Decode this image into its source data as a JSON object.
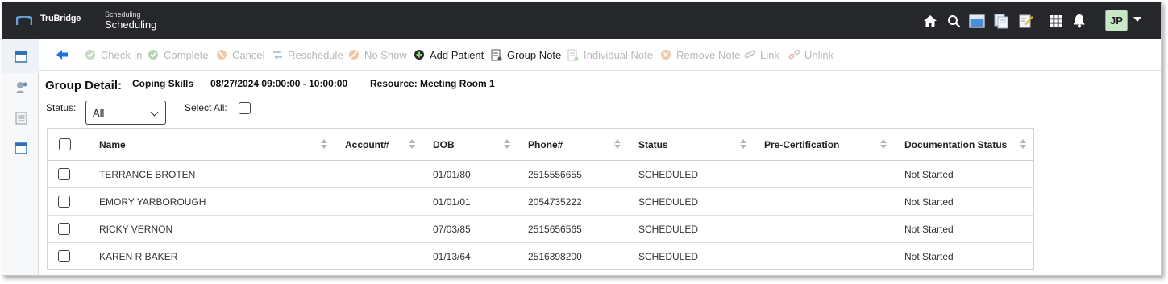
{
  "header": {
    "brand": "TruBridge",
    "app_subtitle": "Scheduling",
    "app_title": "Scheduling",
    "icons": [
      "home-icon",
      "search-icon",
      "window-icon",
      "documents-icon",
      "notes-icon",
      "apps-grid-icon",
      "bell-icon"
    ],
    "user_initials": "JP"
  },
  "sidebar": {
    "items": [
      "calendar-icon",
      "provider-icon",
      "list-report-icon",
      "schedule-window-icon"
    ]
  },
  "toolbar": {
    "back": "back-arrow-icon",
    "items": [
      {
        "label": "Check-in",
        "icon": "check-circle-icon",
        "enabled": false
      },
      {
        "label": "Complete",
        "icon": "complete-circle-icon",
        "enabled": false
      },
      {
        "label": "Cancel",
        "icon": "cancel-circle-icon",
        "enabled": false
      },
      {
        "label": "Reschedule",
        "icon": "reschedule-icon",
        "enabled": false
      },
      {
        "label": "No Show",
        "icon": "no-show-icon",
        "enabled": false
      },
      {
        "label": "Add Patient",
        "icon": "add-circle-icon",
        "enabled": true
      },
      {
        "label": "Group Note",
        "icon": "group-note-icon",
        "enabled": true
      },
      {
        "label": "Individual Note",
        "icon": "individual-note-icon",
        "enabled": false
      },
      {
        "label": "Remove Note",
        "icon": "remove-note-icon",
        "enabled": false
      },
      {
        "label": "Link",
        "icon": "link-icon",
        "enabled": false
      },
      {
        "label": "Unlink",
        "icon": "unlink-icon",
        "enabled": false
      }
    ]
  },
  "group": {
    "title": "Group Detail:",
    "name": "Coping Skills",
    "datetime": "08/27/2024 09:00:00 - 10:00:00",
    "resource": "Resource: Meeting Room 1"
  },
  "filters": {
    "status_label": "Status:",
    "status_value": "All",
    "select_all_label": "Select All:"
  },
  "table": {
    "columns": [
      "Name",
      "Account#",
      "DOB",
      "Phone#",
      "Status",
      "Pre-Certification",
      "Documentation Status"
    ],
    "rows": [
      {
        "name": "TERRANCE BROTEN",
        "account": "",
        "dob": "01/01/80",
        "phone": "2515556655",
        "status": "SCHEDULED",
        "precert": "",
        "doc_status": "Not Started"
      },
      {
        "name": "EMORY YARBOROUGH",
        "account": "",
        "dob": "01/01/01",
        "phone": "2054735222",
        "status": "SCHEDULED",
        "precert": "",
        "doc_status": "Not Started"
      },
      {
        "name": "RICKY VERNON",
        "account": "",
        "dob": "07/03/85",
        "phone": "2515656565",
        "status": "SCHEDULED",
        "precert": "",
        "doc_status": "Not Started"
      },
      {
        "name": "KAREN R BAKER",
        "account": "",
        "dob": "01/13/64",
        "phone": "2516398200",
        "status": "SCHEDULED",
        "precert": "",
        "doc_status": "Not Started"
      }
    ]
  },
  "colors": {
    "topbar": "#25272b",
    "accent_blue": "#1a73e8",
    "disabled_text": "#b8b8b8",
    "avatar_bg": "#c9e6c6"
  }
}
